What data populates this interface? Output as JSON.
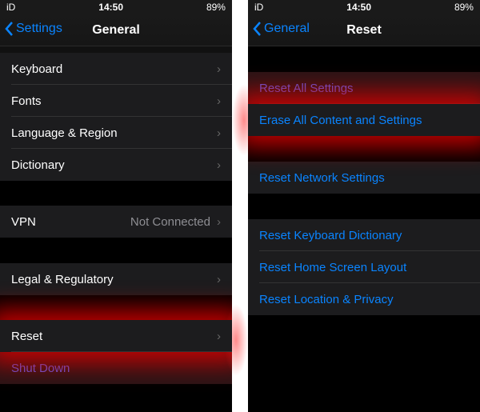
{
  "status": {
    "carrier": "iD",
    "time": "14:50",
    "battery": "89%"
  },
  "left": {
    "back_label": "Settings",
    "title": "General",
    "group1": [
      {
        "label": "Keyboard"
      },
      {
        "label": "Fonts"
      },
      {
        "label": "Language & Region"
      },
      {
        "label": "Dictionary"
      }
    ],
    "vpn": {
      "label": "VPN",
      "value": "Not Connected"
    },
    "legal": {
      "label": "Legal & Regulatory"
    },
    "reset": {
      "label": "Reset"
    },
    "shutdown": {
      "label": "Shut Down"
    }
  },
  "right": {
    "back_label": "General",
    "title": "Reset",
    "group1": [
      {
        "label": "Reset All Settings"
      },
      {
        "label": "Erase All Content and Settings"
      }
    ],
    "group2": [
      {
        "label": "Reset Network Settings"
      }
    ],
    "group3": [
      {
        "label": "Reset Keyboard Dictionary"
      },
      {
        "label": "Reset Home Screen Layout"
      },
      {
        "label": "Reset Location & Privacy"
      }
    ]
  },
  "colors": {
    "accent": "#0a84ff",
    "highlight": "#dc0000"
  }
}
